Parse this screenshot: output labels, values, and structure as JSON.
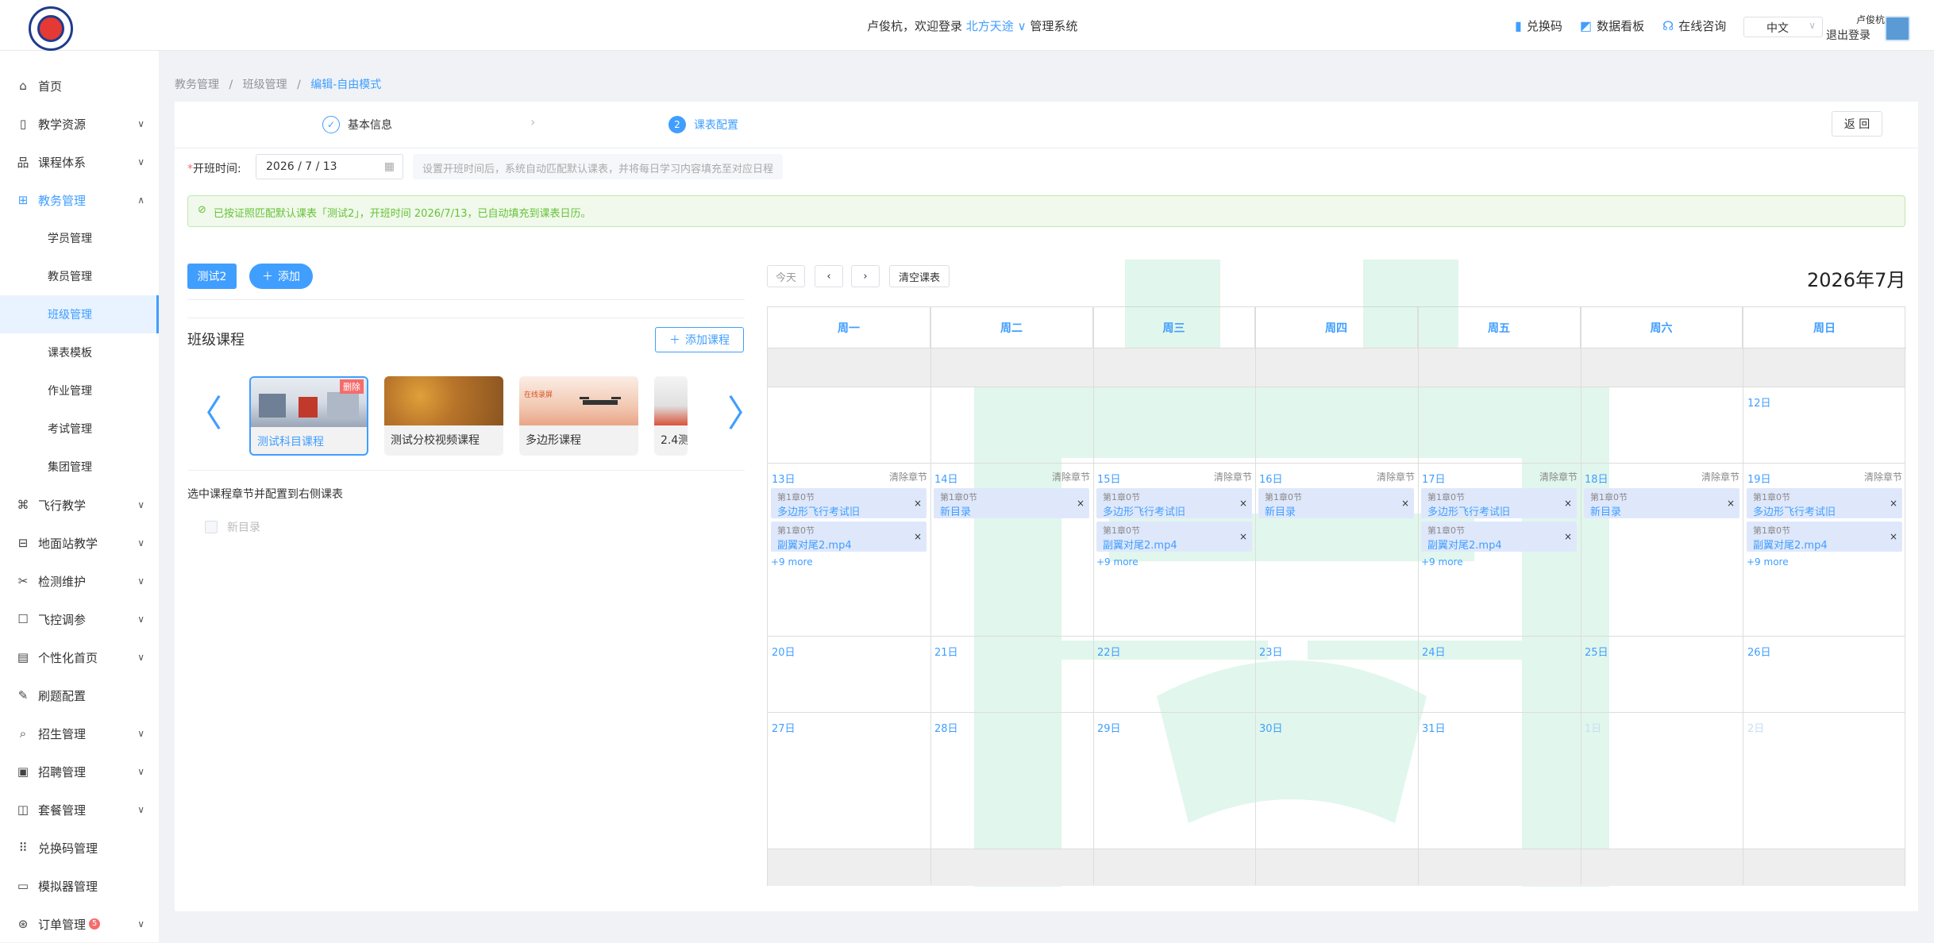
{
  "header": {
    "welcome_prefix": "卢俊杭，欢迎登录",
    "org": "北方天途",
    "system": "管理系统",
    "links": [
      "兑换码",
      "数据看板",
      "在线咨询"
    ],
    "language": "中文",
    "user": "卢俊杭",
    "logout": "退出登录"
  },
  "sidebar": {
    "items": [
      {
        "label": "首页",
        "icon": "home-icon"
      },
      {
        "label": "教学资源",
        "icon": "book-icon"
      },
      {
        "label": "课程体系",
        "icon": "hierarchy-icon"
      },
      {
        "label": "教务管理",
        "icon": "grid-icon"
      },
      {
        "label": "学员管理"
      },
      {
        "label": "教员管理"
      },
      {
        "label": "班级管理"
      },
      {
        "label": "课表模板"
      },
      {
        "label": "作业管理"
      },
      {
        "label": "考试管理"
      },
      {
        "label": "集团管理"
      },
      {
        "label": "飞行教学",
        "icon": "drone-icon"
      },
      {
        "label": "地面站教学",
        "icon": "station-icon"
      },
      {
        "label": "检测维护",
        "icon": "tools-icon"
      },
      {
        "label": "飞控调参",
        "icon": "square-icon"
      },
      {
        "label": "个性化首页",
        "icon": "page-icon"
      },
      {
        "label": "刷题配置",
        "icon": "edit-icon"
      },
      {
        "label": "招生管理",
        "icon": "search-doc-icon"
      },
      {
        "label": "招聘管理",
        "icon": "briefcase-icon"
      },
      {
        "label": "套餐管理",
        "icon": "package-icon"
      },
      {
        "label": "兑换码管理",
        "icon": "apps-icon"
      },
      {
        "label": "模拟器管理",
        "icon": "monitor-icon"
      },
      {
        "label": "订单管理",
        "icon": "order-icon",
        "badge": "5"
      }
    ]
  },
  "breadcrumb": [
    "教务管理",
    "班级管理",
    "编辑-自由模式"
  ],
  "steps": [
    "基本信息",
    "课表配置"
  ],
  "step_number": "2",
  "back_label": "返 回",
  "form": {
    "start_label": "开班时间:",
    "start_date": "2026 / 7 / 13",
    "hint": "设置开班时间后，系统自动匹配默认课表，并将每日学习内容填充至对应日程"
  },
  "alert": "已按证照匹配默认课表「测试2」，开班时间 2026/7/13，已自动填充到课表日历。",
  "left": {
    "tab": "测试2",
    "add": "添加",
    "section_title": "班级课程",
    "add_course": "添加课程",
    "courses": [
      {
        "title": "测试科目课程",
        "delete": "删除"
      },
      {
        "title": "测试分校视频课程"
      },
      {
        "title": "多边形课程"
      },
      {
        "title": "2.4测"
      }
    ],
    "thumb_text": "在线录屏",
    "select_hint": "选中课程章节并配置到右侧课表",
    "chapter": "新目录"
  },
  "calendar": {
    "today": "今天",
    "prev": "‹",
    "next": "›",
    "clear": "清空课表",
    "title": "2026年7月",
    "weekdays": [
      "周一",
      "周二",
      "周三",
      "周四",
      "周五",
      "周六",
      "周日"
    ],
    "clear_chapter": "清除章节",
    "chapter_label": "第1章0节",
    "more": "+9 more",
    "days": {
      "d12": "12日",
      "week2": [
        "13日",
        "14日",
        "15日",
        "16日",
        "17日",
        "18日",
        "19日"
      ],
      "week3": [
        "20日",
        "21日",
        "22日",
        "23日",
        "24日",
        "25日",
        "26日"
      ],
      "week4": [
        "27日",
        "28日",
        "29日",
        "30日",
        "31日",
        "1日",
        "2日"
      ]
    },
    "events": {
      "mon": [
        "多边形飞行考试旧",
        "副翼对尾2.mp4"
      ],
      "tue": [
        "新目录"
      ],
      "wed": [
        "多边形飞行考试旧",
        "副翼对尾2.mp4"
      ],
      "thu": [
        "新目录"
      ],
      "fri": [
        "多边形飞行考试旧",
        "副翼对尾2.mp4"
      ],
      "sat": [
        "新目录"
      ],
      "sun": [
        "多边形飞行考试旧",
        "副翼对尾2.mp4"
      ]
    }
  },
  "colors": {
    "primary": "#409eff",
    "success_bg": "#f0f9eb",
    "danger": "#f56c6c"
  }
}
